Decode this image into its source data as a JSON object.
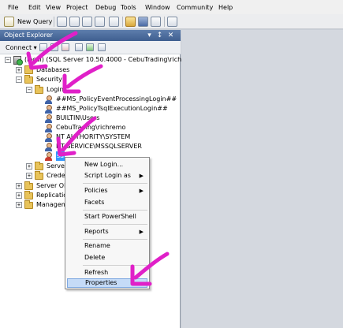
{
  "menubar": {
    "items": [
      "File",
      "Edit",
      "View",
      "Project",
      "Debug",
      "Tools",
      "Window",
      "Community",
      "Help"
    ]
  },
  "toolbar": {
    "new_query_label": "New Query"
  },
  "object_explorer": {
    "title": "Object Explorer",
    "pin_glyph": "↕",
    "close_glyph": "✕",
    "dropdown_glyph": "▾",
    "connect_label": "Connect ▾",
    "tree": {
      "server": "(local) (SQL Server 10.50.4000 - CebuTrading\\richremo)",
      "databases": "Databases",
      "security": "Security",
      "logins": "Logins",
      "login_items": [
        "##MS_PolicyEventProcessingLogin##",
        "##MS_PolicyTsqlExecutionLogin##",
        "BUILTIN\\Users",
        "CebuTrading\\richremo",
        "NT AUTHORITY\\SYSTEM",
        "NT SERVICE\\MSSQLSERVER",
        "sa"
      ],
      "server_roles": "Server Roles",
      "credentials": "Credentials",
      "server_objects": "Server Objects",
      "replication": "Replication",
      "management": "Management"
    }
  },
  "context_menu": {
    "items": {
      "new_login": "New Login...",
      "script_login_as": "Script Login as",
      "policies": "Policies",
      "facets": "Facets",
      "start_powershell": "Start PowerShell",
      "reports": "Reports",
      "rename": "Rename",
      "delete": "Delete",
      "refresh": "Refresh",
      "properties": "Properties"
    },
    "submenu_arrow": "▶"
  },
  "colors": {
    "annotation_arrow": "#e020c8",
    "selection": "#3399ff",
    "highlight": "#c5dbf7"
  }
}
